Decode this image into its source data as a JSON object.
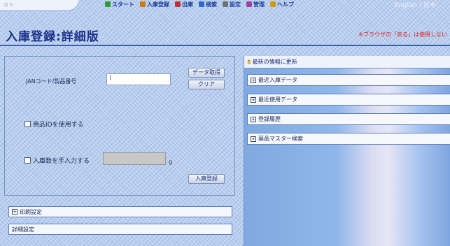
{
  "nav": {
    "items": [
      {
        "label": "スタート",
        "icon": "start-icon",
        "color": "#2e9a3a"
      },
      {
        "label": "入庫登録",
        "icon": "inbound-icon",
        "color": "#d07a10"
      },
      {
        "label": "出庫",
        "icon": "outbound-icon",
        "color": "#c03030"
      },
      {
        "label": "検索",
        "icon": "search-icon",
        "color": "#2f6ad0"
      },
      {
        "label": "設定",
        "icon": "settings-icon",
        "color": "#707070"
      },
      {
        "label": "管理",
        "icon": "admin-icon",
        "color": "#9a40a0"
      },
      {
        "label": "ヘルプ",
        "icon": "help-icon",
        "color": "#d09a10"
      }
    ],
    "lang": "English | 日本"
  },
  "page": {
    "title": "入庫登録:詳細版",
    "notice": "※ブラウザの「戻る」は使用しない"
  },
  "form": {
    "jan_label": "JANコード/製品番号",
    "jan_value": "|",
    "fetch_button": "データ取得",
    "clear_button": "クリア",
    "use_product_id_label": "商品IDを使用する",
    "manual_qty_label": "入庫数を手入力する",
    "qty_unit": "g",
    "register_button": "入庫登録"
  },
  "left_sections": {
    "print_settings": "印刷設定",
    "detail_settings": "詳細設定"
  },
  "right_panel": {
    "header": "最新の情報に更新",
    "sections": [
      "最近入庫データ",
      "最近使用データ",
      "登録履歴",
      "薬品マスター検索"
    ]
  },
  "colors": {
    "title": "#1a2f8a",
    "notice": "#e02020",
    "rule": "#3a5fb0"
  }
}
